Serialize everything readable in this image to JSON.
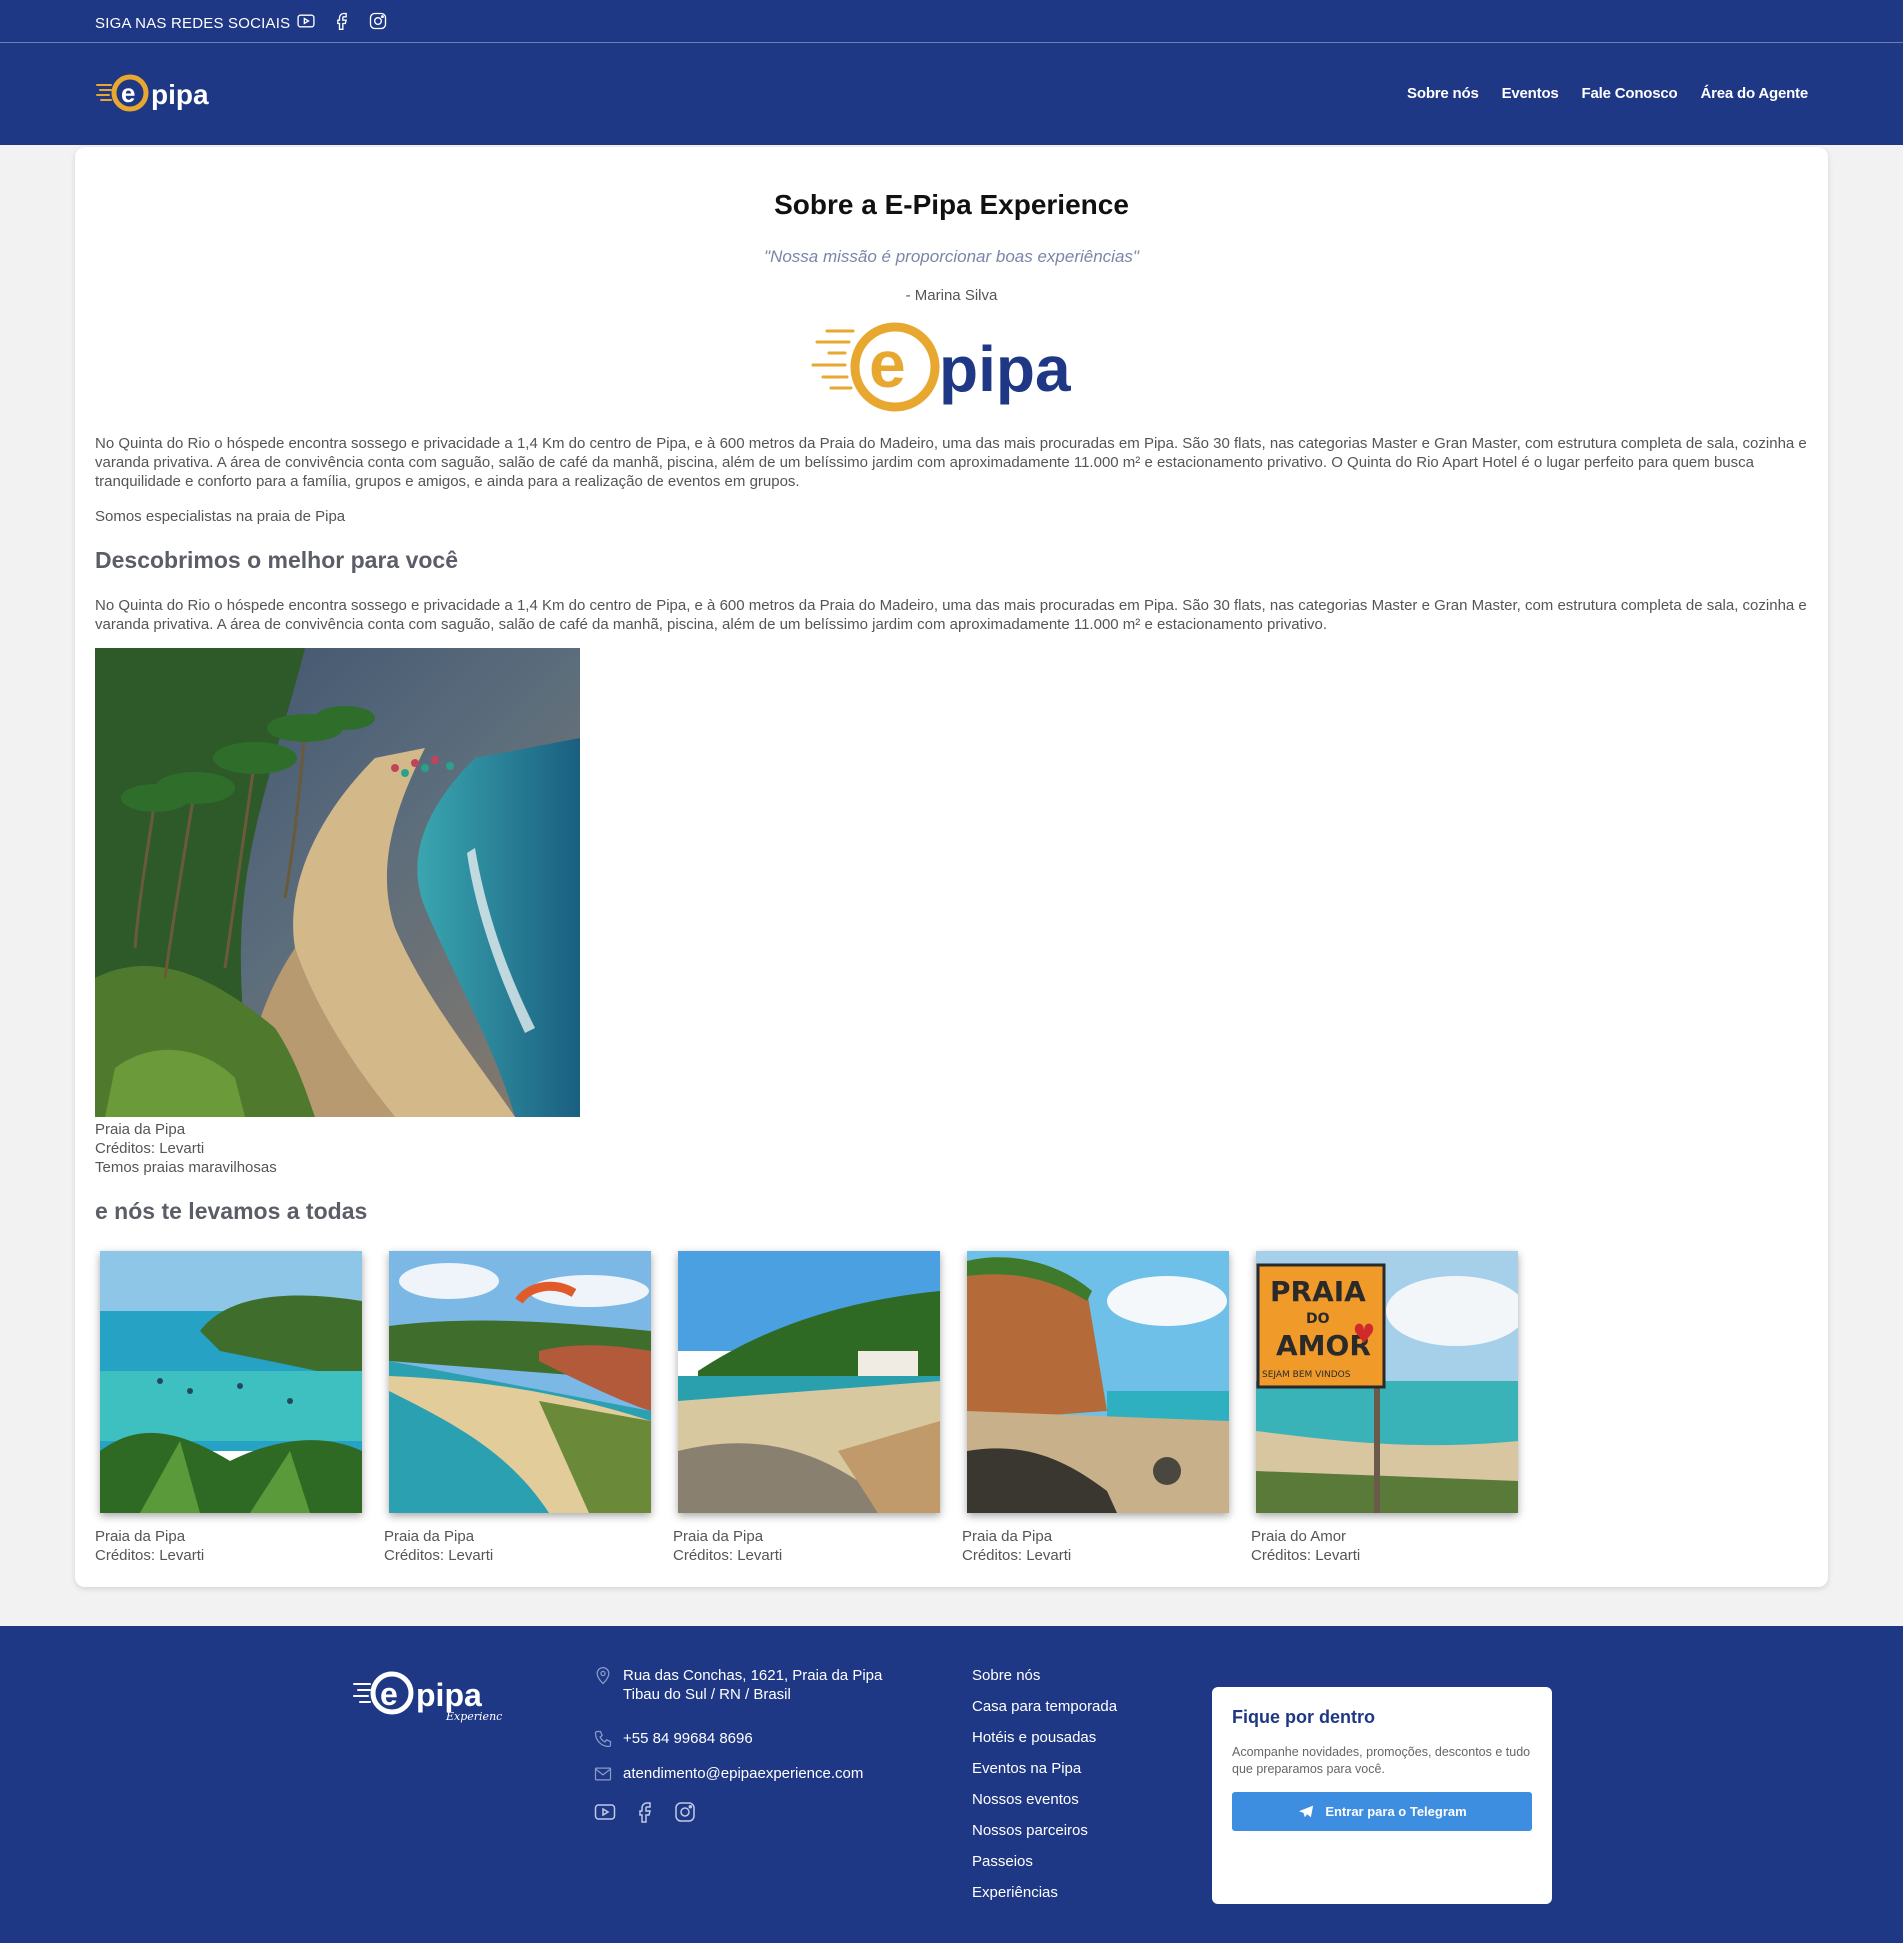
{
  "topbar": {
    "social_label": "SIGA NAS REDES SOCIAIS",
    "icons": [
      "youtube-icon",
      "facebook-icon",
      "instagram-icon"
    ]
  },
  "brand": {
    "logo_text_e": "e",
    "logo_text_pipa": "pipa",
    "footer_logo_sub": "Experience"
  },
  "nav": {
    "items": [
      "Sobre nós",
      "Eventos",
      "Fale Conosco",
      "Área do Agente"
    ]
  },
  "about": {
    "title": "Sobre a E-Pipa Experience",
    "quote": "\"Nossa missão é proporcionar boas experiências\"",
    "author": "- Marina Silva",
    "paragraph1": "No Quinta do Rio o hóspede encontra sossego e privacidade a 1,4 Km do centro de Pipa, e à 600 metros da Praia do Madeiro, uma das mais procuradas em Pipa. São 30 flats, nas categorias Master e Gran Master, com estrutura completa de sala, cozinha e varanda privativa. A área de convivência conta com saguão, salão de café da manhã, piscina, além de um belíssimo jardim com aproximadamente 11.000 m² e estacionamento privativo. O Quinta do Rio Apart Hotel é o lugar perfeito para quem busca tranquilidade e conforto para a família, grupos e amigos, e ainda para a realização de eventos em grupos.",
    "paragraph2": "Somos especialistas na praia de Pipa",
    "heading_discover": "Descobrimos o melhor para você",
    "paragraph3": "No Quinta do Rio o hóspede encontra sossego e privacidade a 1,4 Km do centro de Pipa, e à 600 metros da Praia do Madeiro, uma das mais procuradas em Pipa. São 30 flats, nas categorias Master e Gran Master, com estrutura completa de sala, cozinha e varanda privativa. A área de convivência conta com saguão, salão de café da manhã, piscina, além de um belíssimo jardim com aproximadamente 11.000 m² e estacionamento privativo.",
    "big_photo": {
      "name": "Praia da Pipa",
      "credits": "Créditos: Levarti",
      "tagline": "Temos praias maravilhosas"
    },
    "heading_take": "e nós te levamos a todas",
    "gallery": [
      {
        "name": "Praia da Pipa",
        "credits": "Créditos: Levarti"
      },
      {
        "name": "Praia da Pipa",
        "credits": "Créditos: Levarti"
      },
      {
        "name": "Praia da Pipa",
        "credits": "Créditos: Levarti"
      },
      {
        "name": "Praia da Pipa",
        "credits": "Créditos: Levarti"
      },
      {
        "name": "Praia do Amor",
        "credits": "Créditos: Levarti"
      }
    ],
    "sign": {
      "line1": "PRAIA",
      "line2": "DO",
      "line3": "AMOR",
      "line4": "SEJAM BEM VINDOS"
    }
  },
  "footer": {
    "address_line1": "Rua das Conchas, 1621, Praia da Pipa",
    "address_line2": "Tibau do Sul / RN / Brasil",
    "phone": "+55 84 99684 8696",
    "email": "atendimento@epipaexperience.com",
    "links": [
      "Sobre nós",
      "Casa para temporada",
      "Hotéis e pousadas",
      "Eventos na Pipa",
      "Nossos eventos",
      "Nossos parceiros",
      "Passeios",
      "Experiências"
    ],
    "newsletter": {
      "title": "Fique por dentro",
      "description": "Acompanhe novidades, promoções, descontos e tudo que preparamos para você.",
      "button": "Entrar para o Telegram"
    }
  },
  "colors": {
    "primary": "#1f3885",
    "accent": "#e8a72e",
    "button": "#3d8de0"
  }
}
